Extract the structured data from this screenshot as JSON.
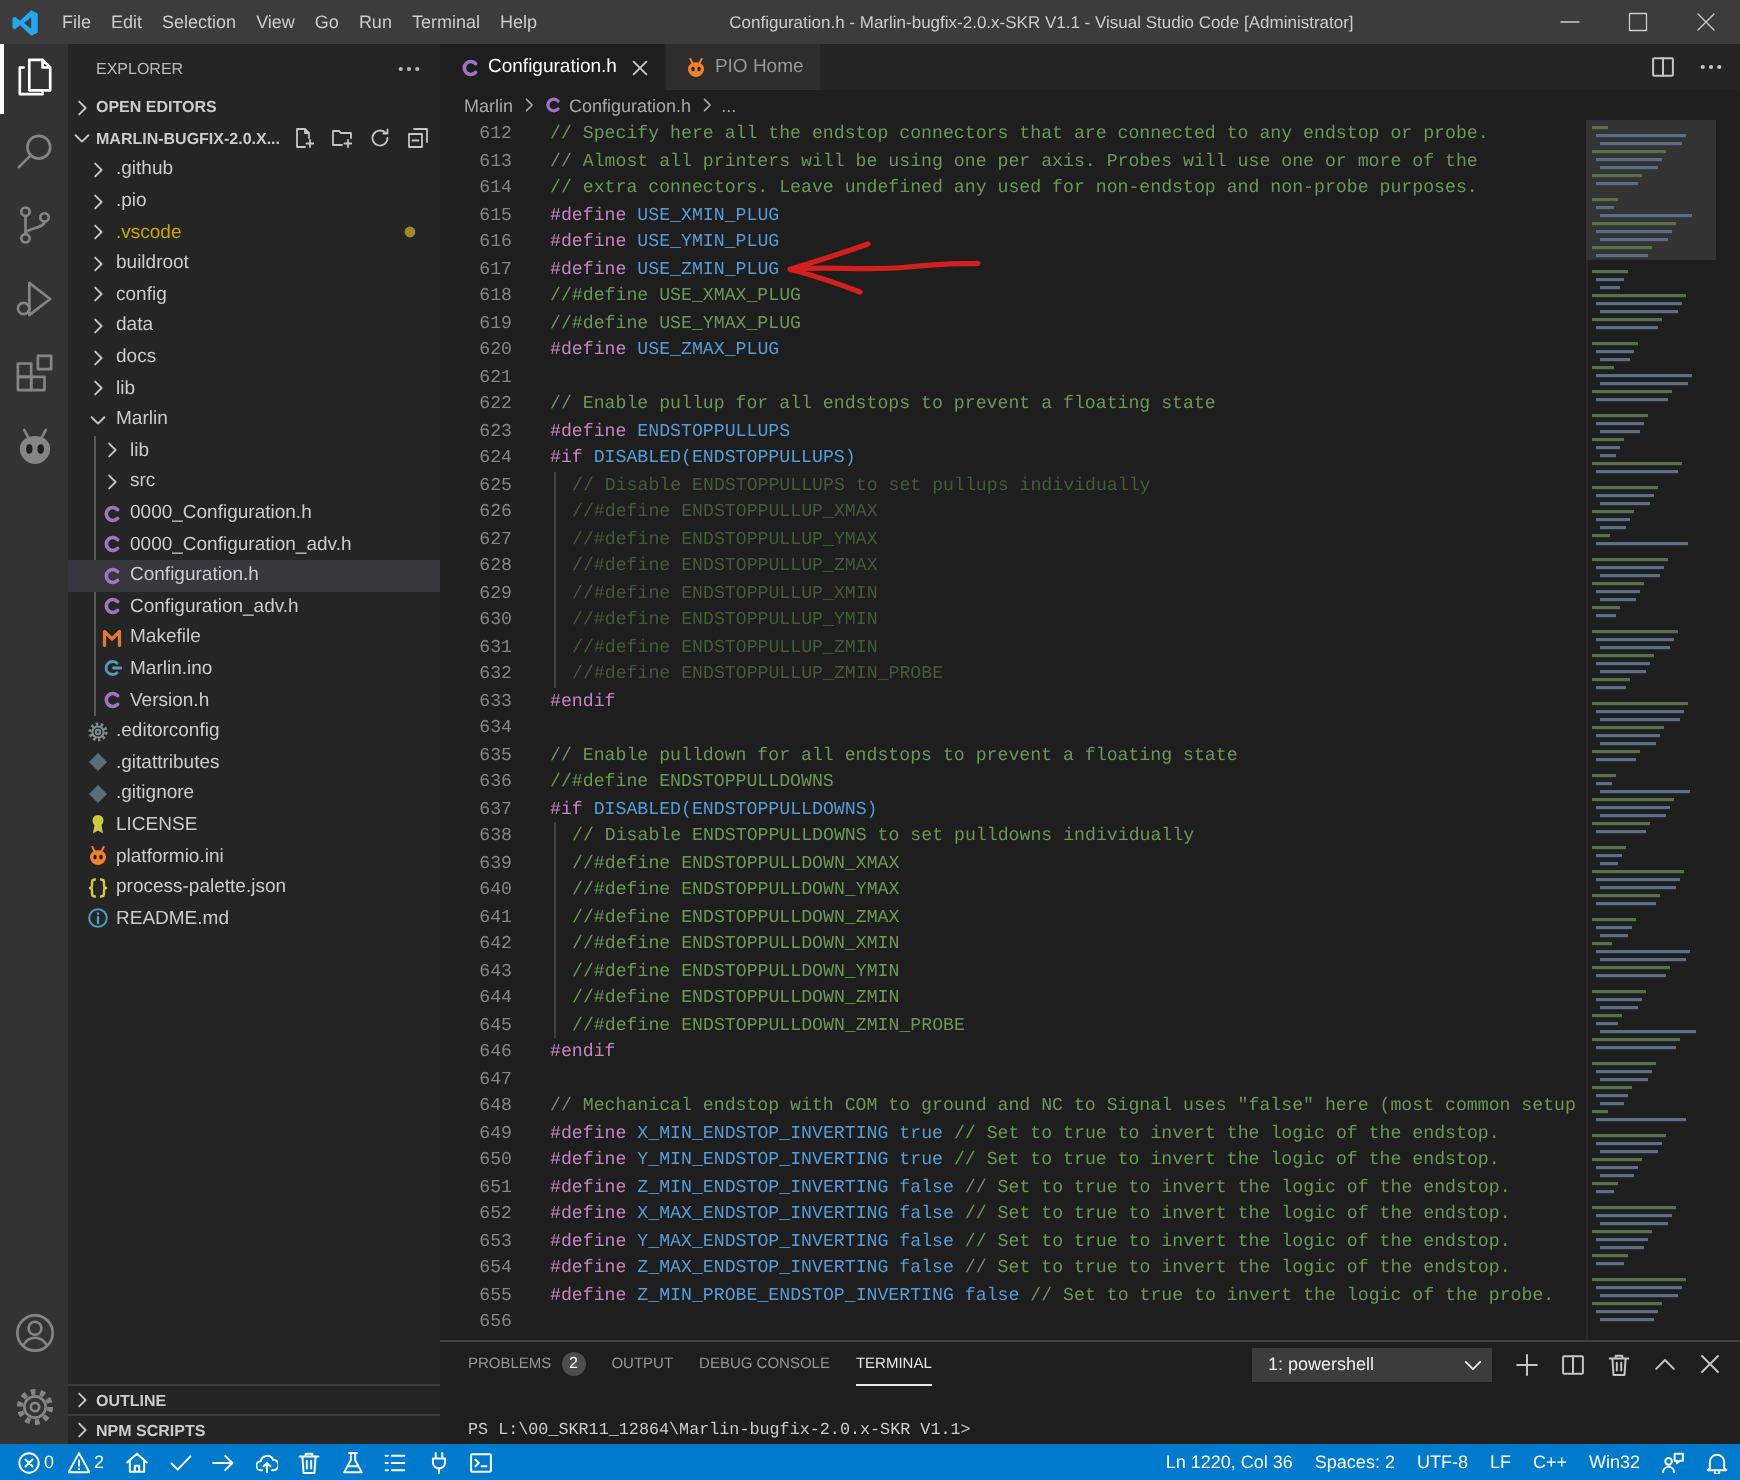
{
  "title_bar": {
    "menu": [
      "File",
      "Edit",
      "Selection",
      "View",
      "Go",
      "Run",
      "Terminal",
      "Help"
    ],
    "title": "Configuration.h - Marlin-bugfix-2.0.x-SKR V1.1 - Visual Studio Code [Administrator]"
  },
  "activity_bar": [
    {
      "kind": "explorer",
      "selected": true
    },
    {
      "kind": "search",
      "selected": false
    },
    {
      "kind": "source-control",
      "selected": false
    },
    {
      "kind": "run",
      "selected": false
    },
    {
      "kind": "extensions",
      "selected": false
    },
    {
      "kind": "platformio",
      "selected": false
    }
  ],
  "explorer": {
    "title": "EXPLORER",
    "sections": [
      {
        "title": "OPEN EDITORS",
        "expanded": false
      },
      {
        "title": "MARLIN-BUGFIX-2.0.X...",
        "expanded": true,
        "items": [
          {
            "label": ".github",
            "kind": "folder",
            "expanded": false,
            "selected": false,
            "warning": false
          },
          {
            "label": ".pio",
            "kind": "folder",
            "expanded": false,
            "selected": false,
            "warning": false
          },
          {
            "label": ".vscode",
            "kind": "folder",
            "expanded": false,
            "selected": false,
            "warning": true
          },
          {
            "label": "buildroot",
            "kind": "folder",
            "expanded": false,
            "selected": false,
            "warning": false
          },
          {
            "label": "config",
            "kind": "folder",
            "expanded": false,
            "selected": false,
            "warning": false
          },
          {
            "label": "data",
            "kind": "folder",
            "expanded": false,
            "selected": false,
            "warning": false
          },
          {
            "label": "docs",
            "kind": "folder",
            "expanded": false,
            "selected": false,
            "warning": false
          },
          {
            "label": "lib",
            "kind": "folder",
            "expanded": false,
            "selected": false,
            "warning": false
          },
          {
            "label": "Marlin",
            "kind": "folder",
            "expanded": true,
            "selected": false,
            "warning": false,
            "children": [
              {
                "label": "lib",
                "kind": "folder",
                "expanded": false,
                "selected": false,
                "warning": false
              },
              {
                "label": "src",
                "kind": "folder",
                "expanded": false,
                "selected": false,
                "warning": false
              },
              {
                "label": "0000_Configuration.h",
                "kind": "c",
                "selected": false,
                "warning": false
              },
              {
                "label": "0000_Configuration_adv.h",
                "kind": "c",
                "selected": false,
                "warning": false
              },
              {
                "label": "Configuration.h",
                "kind": "c",
                "selected": true,
                "warning": false
              },
              {
                "label": "Configuration_adv.h",
                "kind": "c",
                "selected": false,
                "warning": false
              },
              {
                "label": "Makefile",
                "kind": "make",
                "selected": false,
                "warning": false
              },
              {
                "label": "Marlin.ino",
                "kind": "ino",
                "selected": false,
                "warning": false
              },
              {
                "label": "Version.h",
                "kind": "c",
                "selected": false,
                "warning": false
              }
            ]
          },
          {
            "label": ".editorconfig",
            "kind": "config",
            "selected": false,
            "warning": false
          },
          {
            "label": ".gitattributes",
            "kind": "git",
            "selected": false,
            "warning": false
          },
          {
            "label": ".gitignore",
            "kind": "git",
            "selected": false,
            "warning": false
          },
          {
            "label": "LICENSE",
            "kind": "license",
            "selected": false,
            "warning": false
          },
          {
            "label": "platformio.ini",
            "kind": "pio",
            "selected": false,
            "warning": false
          },
          {
            "label": "process-palette.json",
            "kind": "json",
            "selected": false,
            "warning": false
          },
          {
            "label": "README.md",
            "kind": "info",
            "selected": false,
            "warning": false
          }
        ]
      }
    ],
    "bottom_sections": [
      {
        "title": "OUTLINE",
        "expanded": false
      },
      {
        "title": "NPM SCRIPTS",
        "expanded": false
      }
    ]
  },
  "editor": {
    "tabs": [
      {
        "label": "Configuration.h",
        "kind": "c",
        "selected": true
      },
      {
        "label": "PIO Home",
        "kind": "pio",
        "selected": false
      }
    ],
    "breadcrumb": [
      {
        "label": "Marlin",
        "kind": "folder"
      },
      {
        "label": "Configuration.h",
        "kind": "c"
      },
      {
        "label": "...",
        "kind": "more"
      }
    ],
    "lines": [
      {
        "number": "612",
        "dimmed": false,
        "marked": false,
        "tokens": [
          {
            "kind": "comment",
            "text": "// Specify here all the endstop connectors that are connected to any endstop or probe."
          }
        ]
      },
      {
        "number": "613",
        "dimmed": false,
        "marked": false,
        "tokens": [
          {
            "kind": "comment",
            "text": "// Almost all printers will be using one per axis. Probes will use one or more of the"
          }
        ]
      },
      {
        "number": "614",
        "dimmed": false,
        "marked": false,
        "tokens": [
          {
            "kind": "comment",
            "text": "// extra connectors. Leave undefined any used for non-endstop and non-probe purposes."
          }
        ]
      },
      {
        "number": "615",
        "dimmed": false,
        "marked": false,
        "tokens": [
          {
            "kind": "directive",
            "text": "#define"
          },
          {
            "kind": "macro",
            "text": "USE_XMIN_PLUG"
          }
        ]
      },
      {
        "number": "616",
        "dimmed": false,
        "marked": false,
        "tokens": [
          {
            "kind": "directive",
            "text": "#define"
          },
          {
            "kind": "macro",
            "text": "USE_YMIN_PLUG"
          }
        ]
      },
      {
        "number": "617",
        "dimmed": false,
        "marked": true,
        "tokens": [
          {
            "kind": "directive",
            "text": "#define"
          },
          {
            "kind": "macro",
            "text": "USE_ZMIN_PLUG"
          }
        ]
      },
      {
        "number": "618",
        "dimmed": false,
        "marked": false,
        "tokens": [
          {
            "kind": "comment",
            "text": "//#define USE_XMAX_PLUG"
          }
        ]
      },
      {
        "number": "619",
        "dimmed": false,
        "marked": false,
        "tokens": [
          {
            "kind": "comment",
            "text": "//#define USE_YMAX_PLUG"
          }
        ]
      },
      {
        "number": "620",
        "dimmed": false,
        "marked": false,
        "tokens": [
          {
            "kind": "directive",
            "text": "#define"
          },
          {
            "kind": "macro",
            "text": "USE_ZMAX_PLUG"
          }
        ]
      },
      {
        "number": "621",
        "marked": false
      },
      {
        "number": "622",
        "dimmed": false,
        "marked": false,
        "tokens": [
          {
            "kind": "comment",
            "text": "// Enable pullup for all endstops to prevent a floating state"
          }
        ]
      },
      {
        "number": "623",
        "dimmed": false,
        "marked": false,
        "tokens": [
          {
            "kind": "directive",
            "text": "#define"
          },
          {
            "kind": "macro",
            "text": "ENDSTOPPULLUPS"
          }
        ]
      },
      {
        "number": "624",
        "dimmed": false,
        "marked": false,
        "tokens": [
          {
            "kind": "directive",
            "text": "#if"
          },
          {
            "kind": "macro",
            "text": "DISABLED(ENDSTOPPULLUPS)"
          }
        ],
        "children": [
          {
            "number": "625",
            "dimmed": true,
            "marked": false,
            "tokens": [
              {
                "kind": "comment",
                "text": "// Disable ENDSTOPPULLUPS to set pullups individually"
              }
            ]
          },
          {
            "number": "626",
            "dimmed": true,
            "marked": false,
            "tokens": [
              {
                "kind": "comment",
                "text": "//#define ENDSTOPPULLUP_XMAX"
              }
            ]
          },
          {
            "number": "627",
            "dimmed": true,
            "marked": false,
            "tokens": [
              {
                "kind": "comment",
                "text": "//#define ENDSTOPPULLUP_YMAX"
              }
            ]
          },
          {
            "number": "628",
            "dimmed": true,
            "marked": false,
            "tokens": [
              {
                "kind": "comment",
                "text": "//#define ENDSTOPPULLUP_ZMAX"
              }
            ]
          },
          {
            "number": "629",
            "dimmed": true,
            "marked": false,
            "tokens": [
              {
                "kind": "comment",
                "text": "//#define ENDSTOPPULLUP_XMIN"
              }
            ]
          },
          {
            "number": "630",
            "dimmed": true,
            "marked": false,
            "tokens": [
              {
                "kind": "comment",
                "text": "//#define ENDSTOPPULLUP_YMIN"
              }
            ]
          },
          {
            "number": "631",
            "dimmed": true,
            "marked": false,
            "tokens": [
              {
                "kind": "comment",
                "text": "//#define ENDSTOPPULLUP_ZMIN"
              }
            ]
          },
          {
            "number": "632",
            "dimmed": true,
            "marked": false,
            "tokens": [
              {
                "kind": "comment",
                "text": "//#define ENDSTOPPULLUP_ZMIN_PROBE"
              }
            ]
          }
        ]
      },
      {
        "number": "633",
        "dimmed": false,
        "marked": false,
        "tokens": [
          {
            "kind": "directive",
            "text": "#endif"
          }
        ]
      },
      {
        "number": "634",
        "marked": false
      },
      {
        "number": "635",
        "dimmed": false,
        "marked": false,
        "tokens": [
          {
            "kind": "comment",
            "text": "// Enable pulldown for all endstops to prevent a floating state"
          }
        ]
      },
      {
        "number": "636",
        "dimmed": false,
        "marked": false,
        "tokens": [
          {
            "kind": "comment",
            "text": "//#define ENDSTOPPULLDOWNS"
          }
        ]
      },
      {
        "number": "637",
        "dimmed": false,
        "marked": false,
        "tokens": [
          {
            "kind": "directive",
            "text": "#if"
          },
          {
            "kind": "macro",
            "text": "DISABLED(ENDSTOPPULLDOWNS)"
          }
        ],
        "children": [
          {
            "number": "638",
            "dimmed": false,
            "marked": false,
            "tokens": [
              {
                "kind": "comment",
                "text": "// Disable ENDSTOPPULLDOWNS to set pulldowns individually"
              }
            ]
          },
          {
            "number": "639",
            "dimmed": false,
            "marked": false,
            "tokens": [
              {
                "kind": "comment",
                "text": "//#define ENDSTOPPULLDOWN_XMAX"
              }
            ]
          },
          {
            "number": "640",
            "dimmed": false,
            "marked": false,
            "tokens": [
              {
                "kind": "comment",
                "text": "//#define ENDSTOPPULLDOWN_YMAX"
              }
            ]
          },
          {
            "number": "641",
            "dimmed": false,
            "marked": false,
            "tokens": [
              {
                "kind": "comment",
                "text": "//#define ENDSTOPPULLDOWN_ZMAX"
              }
            ]
          },
          {
            "number": "642",
            "dimmed": false,
            "marked": false,
            "tokens": [
              {
                "kind": "comment",
                "text": "//#define ENDSTOPPULLDOWN_XMIN"
              }
            ]
          },
          {
            "number": "643",
            "dimmed": false,
            "marked": false,
            "tokens": [
              {
                "kind": "comment",
                "text": "//#define ENDSTOPPULLDOWN_YMIN"
              }
            ]
          },
          {
            "number": "644",
            "dimmed": false,
            "marked": false,
            "tokens": [
              {
                "kind": "comment",
                "text": "//#define ENDSTOPPULLDOWN_ZMIN"
              }
            ]
          },
          {
            "number": "645",
            "dimmed": false,
            "marked": false,
            "tokens": [
              {
                "kind": "comment",
                "text": "//#define ENDSTOPPULLDOWN_ZMIN_PROBE"
              }
            ]
          }
        ]
      },
      {
        "number": "646",
        "dimmed": false,
        "marked": false,
        "tokens": [
          {
            "kind": "directive",
            "text": "#endif"
          }
        ]
      },
      {
        "number": "647",
        "marked": false
      },
      {
        "number": "648",
        "dimmed": false,
        "marked": false,
        "tokens": [
          {
            "kind": "comment",
            "text": "// Mechanical endstop with COM to ground and NC to Signal uses \"false\" here (most common setup"
          }
        ]
      },
      {
        "number": "649",
        "dimmed": false,
        "marked": false,
        "tokens": [
          {
            "kind": "directive",
            "text": "#define"
          },
          {
            "kind": "macro",
            "text": "X_MIN_ENDSTOP_INVERTING"
          },
          {
            "kind": "constant",
            "text": "true"
          },
          {
            "kind": "comment",
            "text": "// Set to true to invert the logic of the endstop."
          }
        ]
      },
      {
        "number": "650",
        "dimmed": false,
        "marked": false,
        "tokens": [
          {
            "kind": "directive",
            "text": "#define"
          },
          {
            "kind": "macro",
            "text": "Y_MIN_ENDSTOP_INVERTING"
          },
          {
            "kind": "constant",
            "text": "true"
          },
          {
            "kind": "comment",
            "text": "// Set to true to invert the logic of the endstop."
          }
        ]
      },
      {
        "number": "651",
        "dimmed": false,
        "marked": false,
        "tokens": [
          {
            "kind": "directive",
            "text": "#define"
          },
          {
            "kind": "macro",
            "text": "Z_MIN_ENDSTOP_INVERTING"
          },
          {
            "kind": "constant",
            "text": "false"
          },
          {
            "kind": "comment",
            "text": "// Set to true to invert the logic of the endstop."
          }
        ]
      },
      {
        "number": "652",
        "dimmed": false,
        "marked": false,
        "tokens": [
          {
            "kind": "directive",
            "text": "#define"
          },
          {
            "kind": "macro",
            "text": "X_MAX_ENDSTOP_INVERTING"
          },
          {
            "kind": "constant",
            "text": "false"
          },
          {
            "kind": "comment",
            "text": "// Set to true to invert the logic of the endstop."
          }
        ]
      },
      {
        "number": "653",
        "dimmed": false,
        "marked": false,
        "tokens": [
          {
            "kind": "directive",
            "text": "#define"
          },
          {
            "kind": "macro",
            "text": "Y_MAX_ENDSTOP_INVERTING"
          },
          {
            "kind": "constant",
            "text": "false"
          },
          {
            "kind": "comment",
            "text": "// Set to true to invert the logic of the endstop."
          }
        ]
      },
      {
        "number": "654",
        "dimmed": false,
        "marked": false,
        "tokens": [
          {
            "kind": "directive",
            "text": "#define"
          },
          {
            "kind": "macro",
            "text": "Z_MAX_ENDSTOP_INVERTING"
          },
          {
            "kind": "constant",
            "text": "false"
          },
          {
            "kind": "comment",
            "text": "// Set to true to invert the logic of the endstop."
          }
        ]
      },
      {
        "number": "655",
        "dimmed": false,
        "marked": false,
        "tokens": [
          {
            "kind": "directive",
            "text": "#define"
          },
          {
            "kind": "macro",
            "text": "Z_MIN_PROBE_ENDSTOP_INVERTING"
          },
          {
            "kind": "constant",
            "text": "false"
          },
          {
            "kind": "comment",
            "text": "// Set to true to invert the logic of the probe."
          }
        ]
      },
      {
        "number": "656",
        "marked": false
      }
    ]
  },
  "panel": {
    "tabs": [
      {
        "label": "PROBLEMS",
        "badge": "2",
        "selected": false
      },
      {
        "label": "OUTPUT",
        "selected": false
      },
      {
        "label": "DEBUG CONSOLE",
        "selected": false
      },
      {
        "label": "TERMINAL",
        "selected": true
      }
    ],
    "terminal_select": "1: powershell",
    "terminal_output": "PS L:\\00_SKR11_12864\\Marlin-bugfix-2.0.x-SKR V1.1>"
  },
  "status_bar": {
    "errors": "0",
    "warnings": "2",
    "right": [
      "Ln 1220, Col 36",
      "Spaces: 2",
      "UTF-8",
      "LF",
      "C++",
      "Win32"
    ]
  }
}
